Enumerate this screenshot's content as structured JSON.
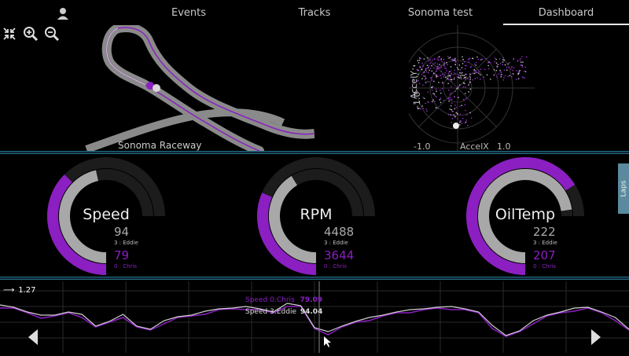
{
  "nav": {
    "tabs": [
      "Events",
      "Tracks",
      "Sonoma test",
      "Dashboard"
    ],
    "active": "Dashboard",
    "user_icon": "user-icon"
  },
  "map": {
    "track_name": "Sonoma Raceway",
    "tools": [
      "fit-screen-icon",
      "zoom-in-icon",
      "zoom-out-icon"
    ],
    "colors": {
      "track": "#9a9a9a",
      "lap_line": "#8b1fc2"
    }
  },
  "gg_plot": {
    "x_label": "AccelX",
    "y_label": "AccelY",
    "x_min_label": "-1.0",
    "x_max_label": "1.0",
    "y_min_label": "-1.0",
    "y_max_label": "1.0"
  },
  "gauges": [
    {
      "name": "Speed",
      "value_a": "94",
      "driver_a": "3 : Eddie",
      "value_b": "79",
      "driver_b": "0 : Chris",
      "fill_a": 0.62,
      "fill_b": 0.5
    },
    {
      "name": "RPM",
      "value_a": "4488",
      "driver_a": "3 : Eddie",
      "value_b": "3644",
      "driver_b": "0 : Chris",
      "fill_a": 0.55,
      "fill_b": 0.42
    },
    {
      "name": "OilTemp",
      "value_a": "222",
      "driver_a": "3 : Eddie",
      "value_b": "207",
      "driver_b": "0 : Chris",
      "fill_a": 0.97,
      "fill_b": 0.88
    }
  ],
  "laps_tab": "Laps",
  "chart": {
    "cursor_value": "1.27",
    "tooltip_b_label": "Speed 0:Chris",
    "tooltip_b_value": "79.09",
    "tooltip_a_label": "Speed 3:Eddie",
    "tooltip_a_value": "94.04",
    "colors": {
      "eddie": "#cfcfcf",
      "chris": "#8b1fc2"
    }
  }
}
